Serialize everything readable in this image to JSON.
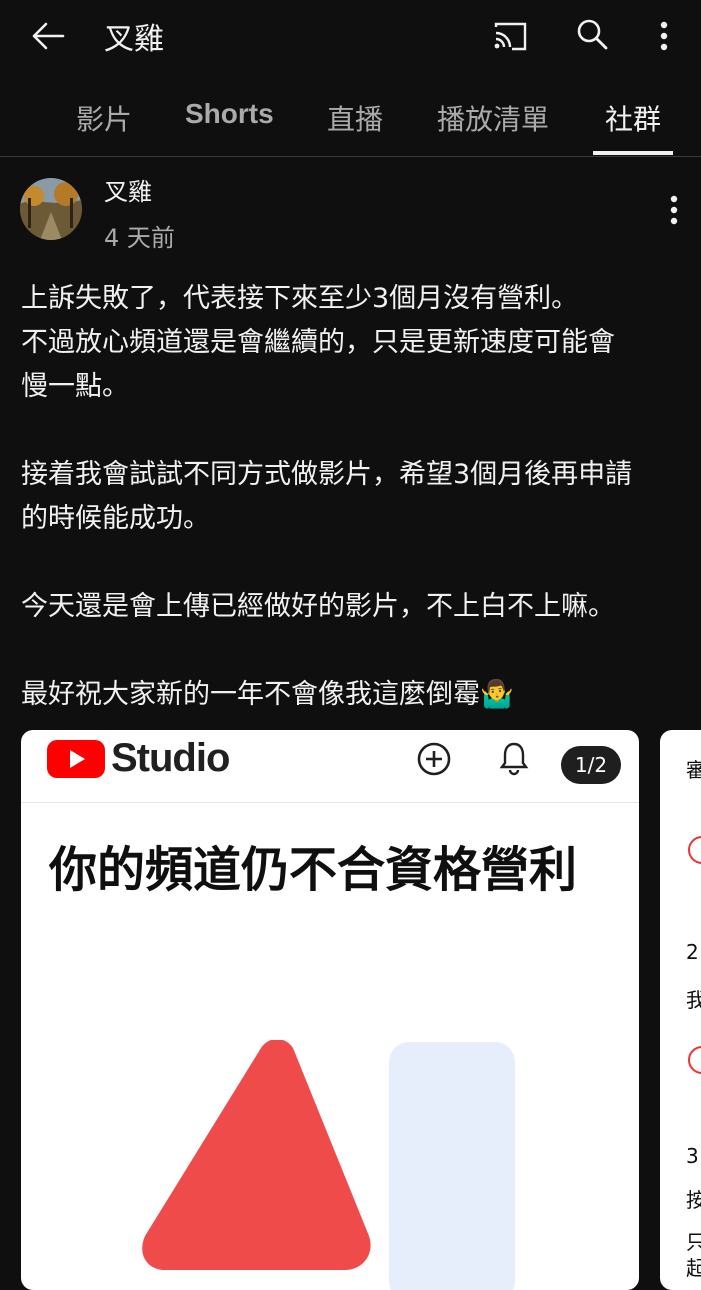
{
  "header": {
    "channel_title": "叉雞"
  },
  "tabs": [
    {
      "label": "影片"
    },
    {
      "label": "Shorts"
    },
    {
      "label": "直播"
    },
    {
      "label": "播放清單"
    },
    {
      "label": "社群",
      "active": true
    }
  ],
  "post": {
    "author": "叉雞",
    "time": "4 天前",
    "paragraphs": [
      [
        "上訴失敗了，代表接下來至少3個月沒有營利。",
        "不過放心頻道還是會繼續的，只是更新速度可能會",
        "慢一點。"
      ],
      [
        "接着我會試試不同方式做影片，希望3個月後再申請",
        "的時候能成功。"
      ],
      [
        "今天還是會上傳已經做好的影片，不上白不上嘛。"
      ],
      [
        "最好祝大家新的一年不會像我這麼倒霉🤷‍♂️"
      ]
    ],
    "emoji": "🤷‍♂️"
  },
  "image_card": {
    "brand": "Studio",
    "counter": "1/2",
    "headline": "你的頻道仍不合資格營利"
  },
  "next_card": {
    "fragments": [
      "審",
      "2",
      "我",
      "3",
      "按",
      "只",
      "起"
    ]
  },
  "colors": {
    "background": "#0f0f0f",
    "youtube_red": "#ff0000",
    "warning_red": "#f04b4b",
    "pale_blue": "#e6eefc"
  },
  "icons": [
    "back-arrow-icon",
    "cast-icon",
    "search-icon",
    "more-vert-icon",
    "add-circle-icon",
    "bell-icon"
  ]
}
